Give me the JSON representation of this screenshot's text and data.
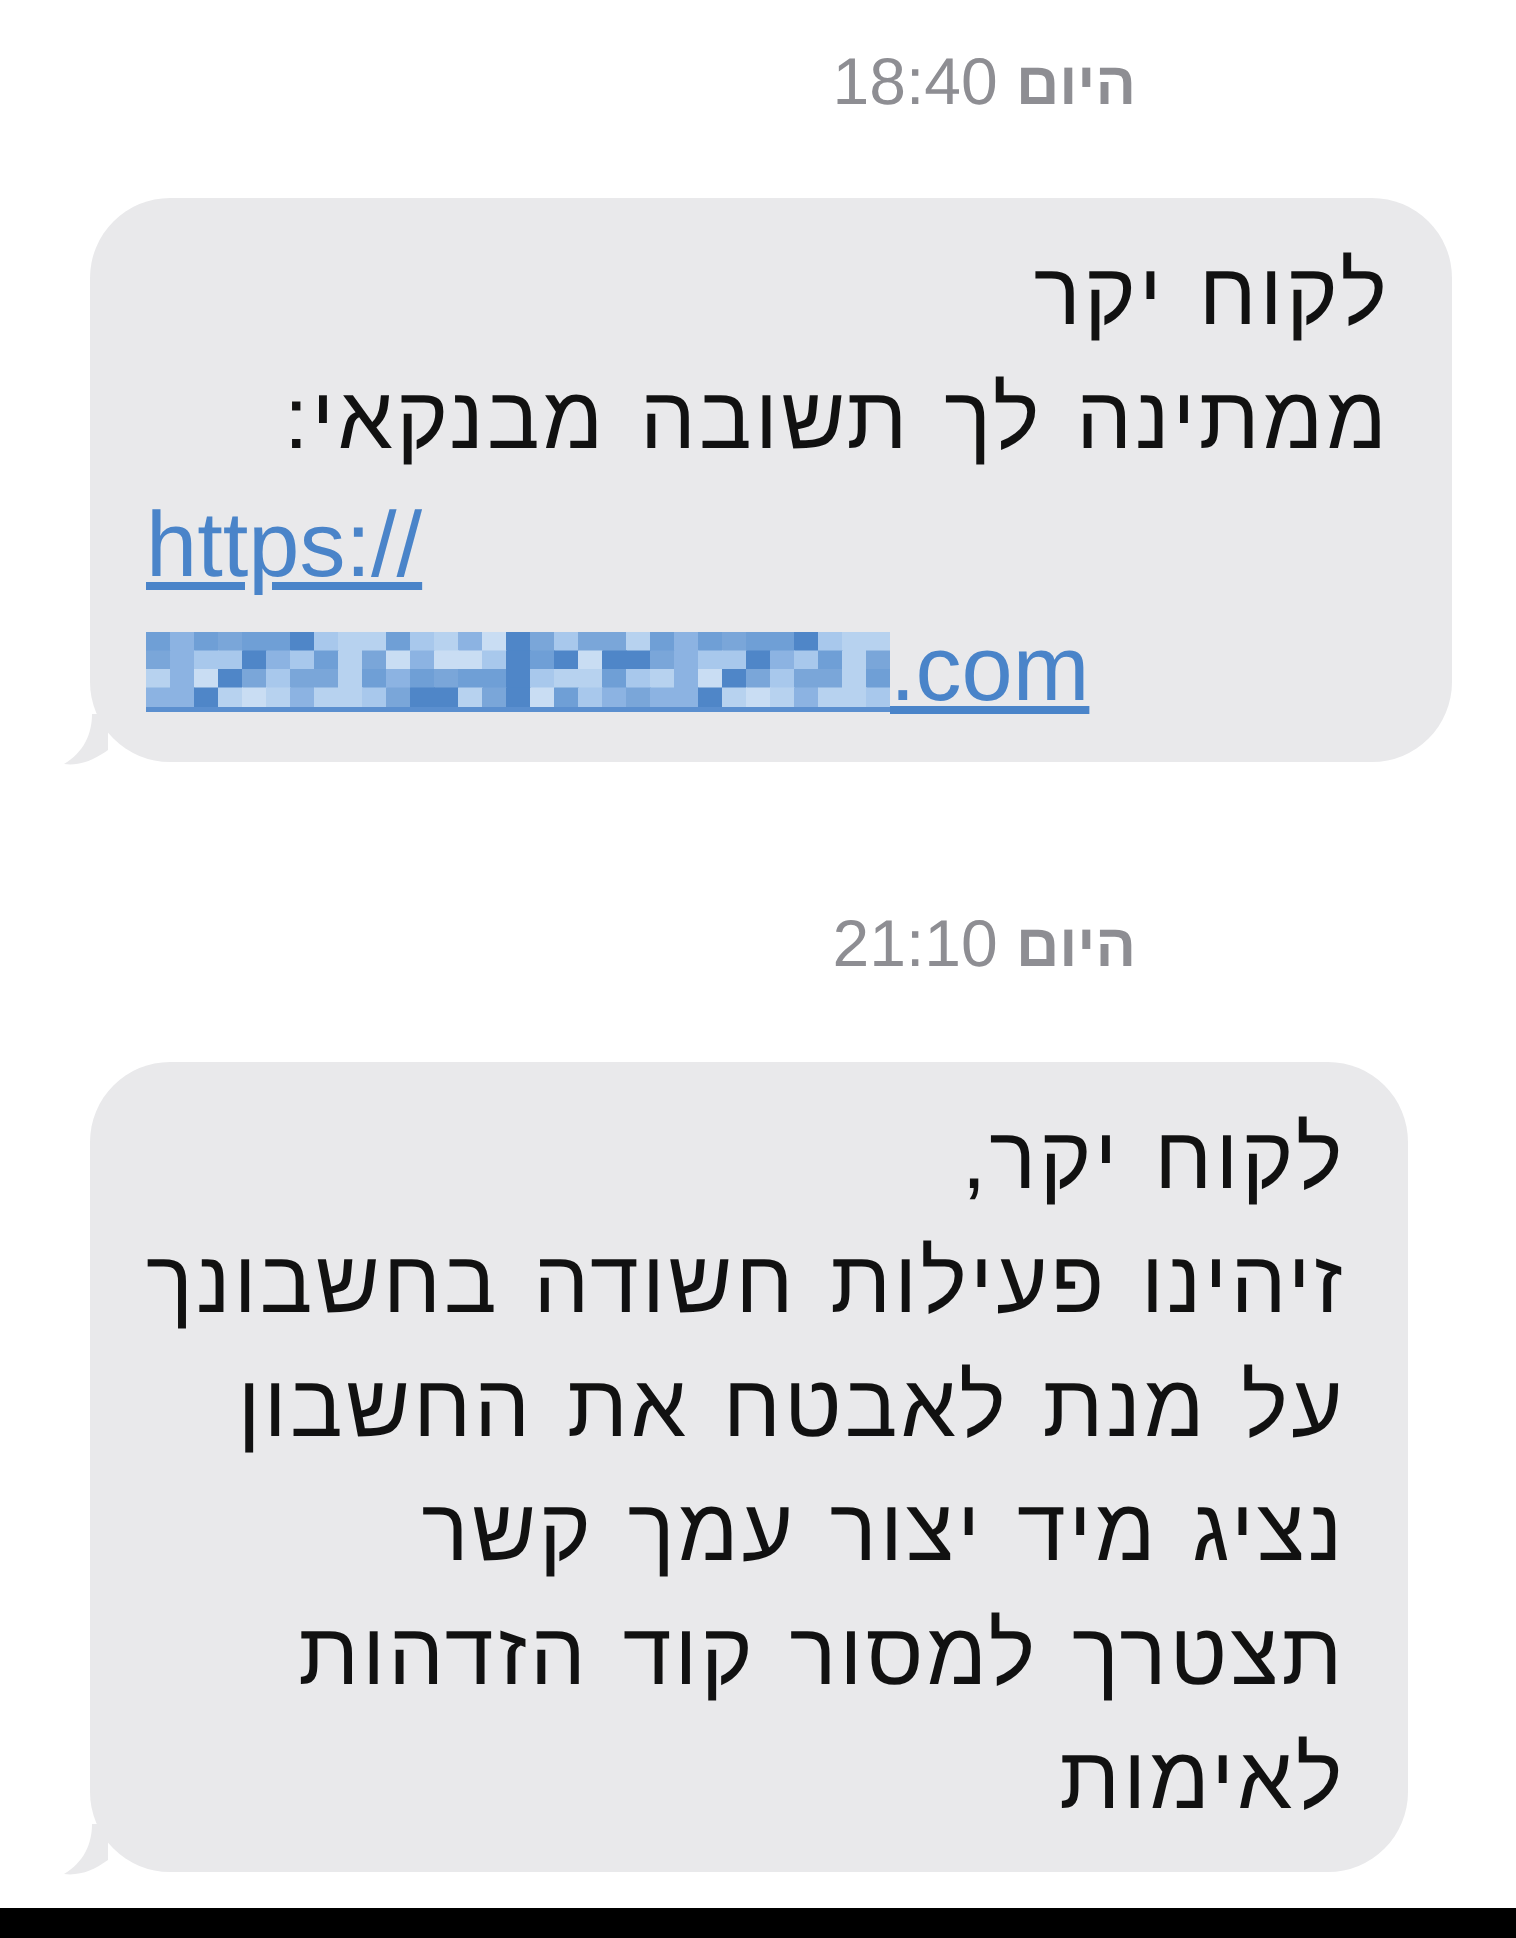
{
  "conversation": [
    {
      "timestamp": "**היום** 18:40",
      "bubble": {
        "lines": [
          "לקוח יקר",
          "ממתינה לך תשובה מבנקאי:"
        ],
        "link": {
          "first_line": "https://",
          "redacted": true,
          "last_line_end": ".com"
        }
      }
    },
    {
      "timestamp": "**היום** 21:10",
      "bubble": {
        "lines": [
          "לקוח יקר,",
          "זיהינו פעילות חשודה בחשבונך",
          "על מנת לאבטח את החשבון",
          "נציג מיד יצור עמך קשר",
          "תצטרך למסור קוד הזדהות",
          "לאימות"
        ]
      }
    }
  ]
}
